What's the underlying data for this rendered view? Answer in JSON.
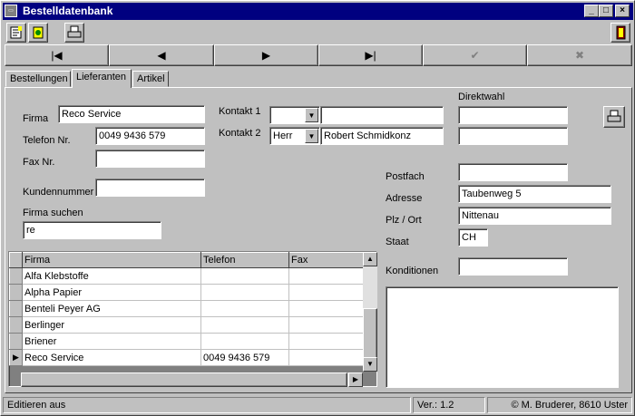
{
  "window": {
    "title": "Bestelldatenbank"
  },
  "toolbar": {
    "icon1": "notebook-icon",
    "icon2": "database-icon",
    "icon3": "printer-icon",
    "icon4": "exit-door-icon"
  },
  "nav": {
    "first": "|◀",
    "prev": "◀",
    "next": "▶",
    "last": "▶|",
    "confirm": "✔",
    "cancel": "✖"
  },
  "tabs": [
    "Bestellungen",
    "Lieferanten",
    "Artikel"
  ],
  "form": {
    "firma_label": "Firma",
    "firma_value": "Reco Service",
    "telefon_label": "Telefon Nr.",
    "telefon_value": "0049 9436 579",
    "fax_label": "Fax Nr.",
    "fax_value": "",
    "kundennummer_label": "Kundennummer",
    "kundennummer_value": "",
    "firma_suchen_label": "Firma suchen",
    "firma_suchen_value": "re",
    "kontakt1_label": "Kontakt 1",
    "kontakt1_anrede": "",
    "kontakt1_name": "",
    "kontakt2_label": "Kontakt 2",
    "kontakt2_anrede": "Herr",
    "kontakt2_name": "Robert Schmidkonz",
    "direktwahl_label": "Direktwahl",
    "direktwahl1": "",
    "direktwahl2": "",
    "postfach_label": "Postfach",
    "postfach_value": "",
    "adresse_label": "Adresse",
    "adresse_value": "Taubenweg 5",
    "plz_label": "Plz / Ort",
    "plz_value": "Nittenau",
    "staat_label": "Staat",
    "staat_value": "CH",
    "konditionen_label": "Konditionen",
    "konditionen_value": "",
    "notes_value": ""
  },
  "grid": {
    "headers": [
      "Firma",
      "Telefon",
      "Fax"
    ],
    "rows": [
      [
        "Alfa Klebstoffe",
        "",
        ""
      ],
      [
        "Alpha Papier",
        "",
        ""
      ],
      [
        "Benteli Peyer AG",
        "",
        ""
      ],
      [
        "Berlinger",
        "",
        ""
      ],
      [
        "Briener",
        "",
        ""
      ],
      [
        "Reco Service",
        "0049 9436 579",
        ""
      ]
    ],
    "current_marker": "▶"
  },
  "status": {
    "mode": "Editieren aus",
    "version": "Ver.: 1.2",
    "copyright": "© M. Bruderer, 8610 Uster"
  }
}
